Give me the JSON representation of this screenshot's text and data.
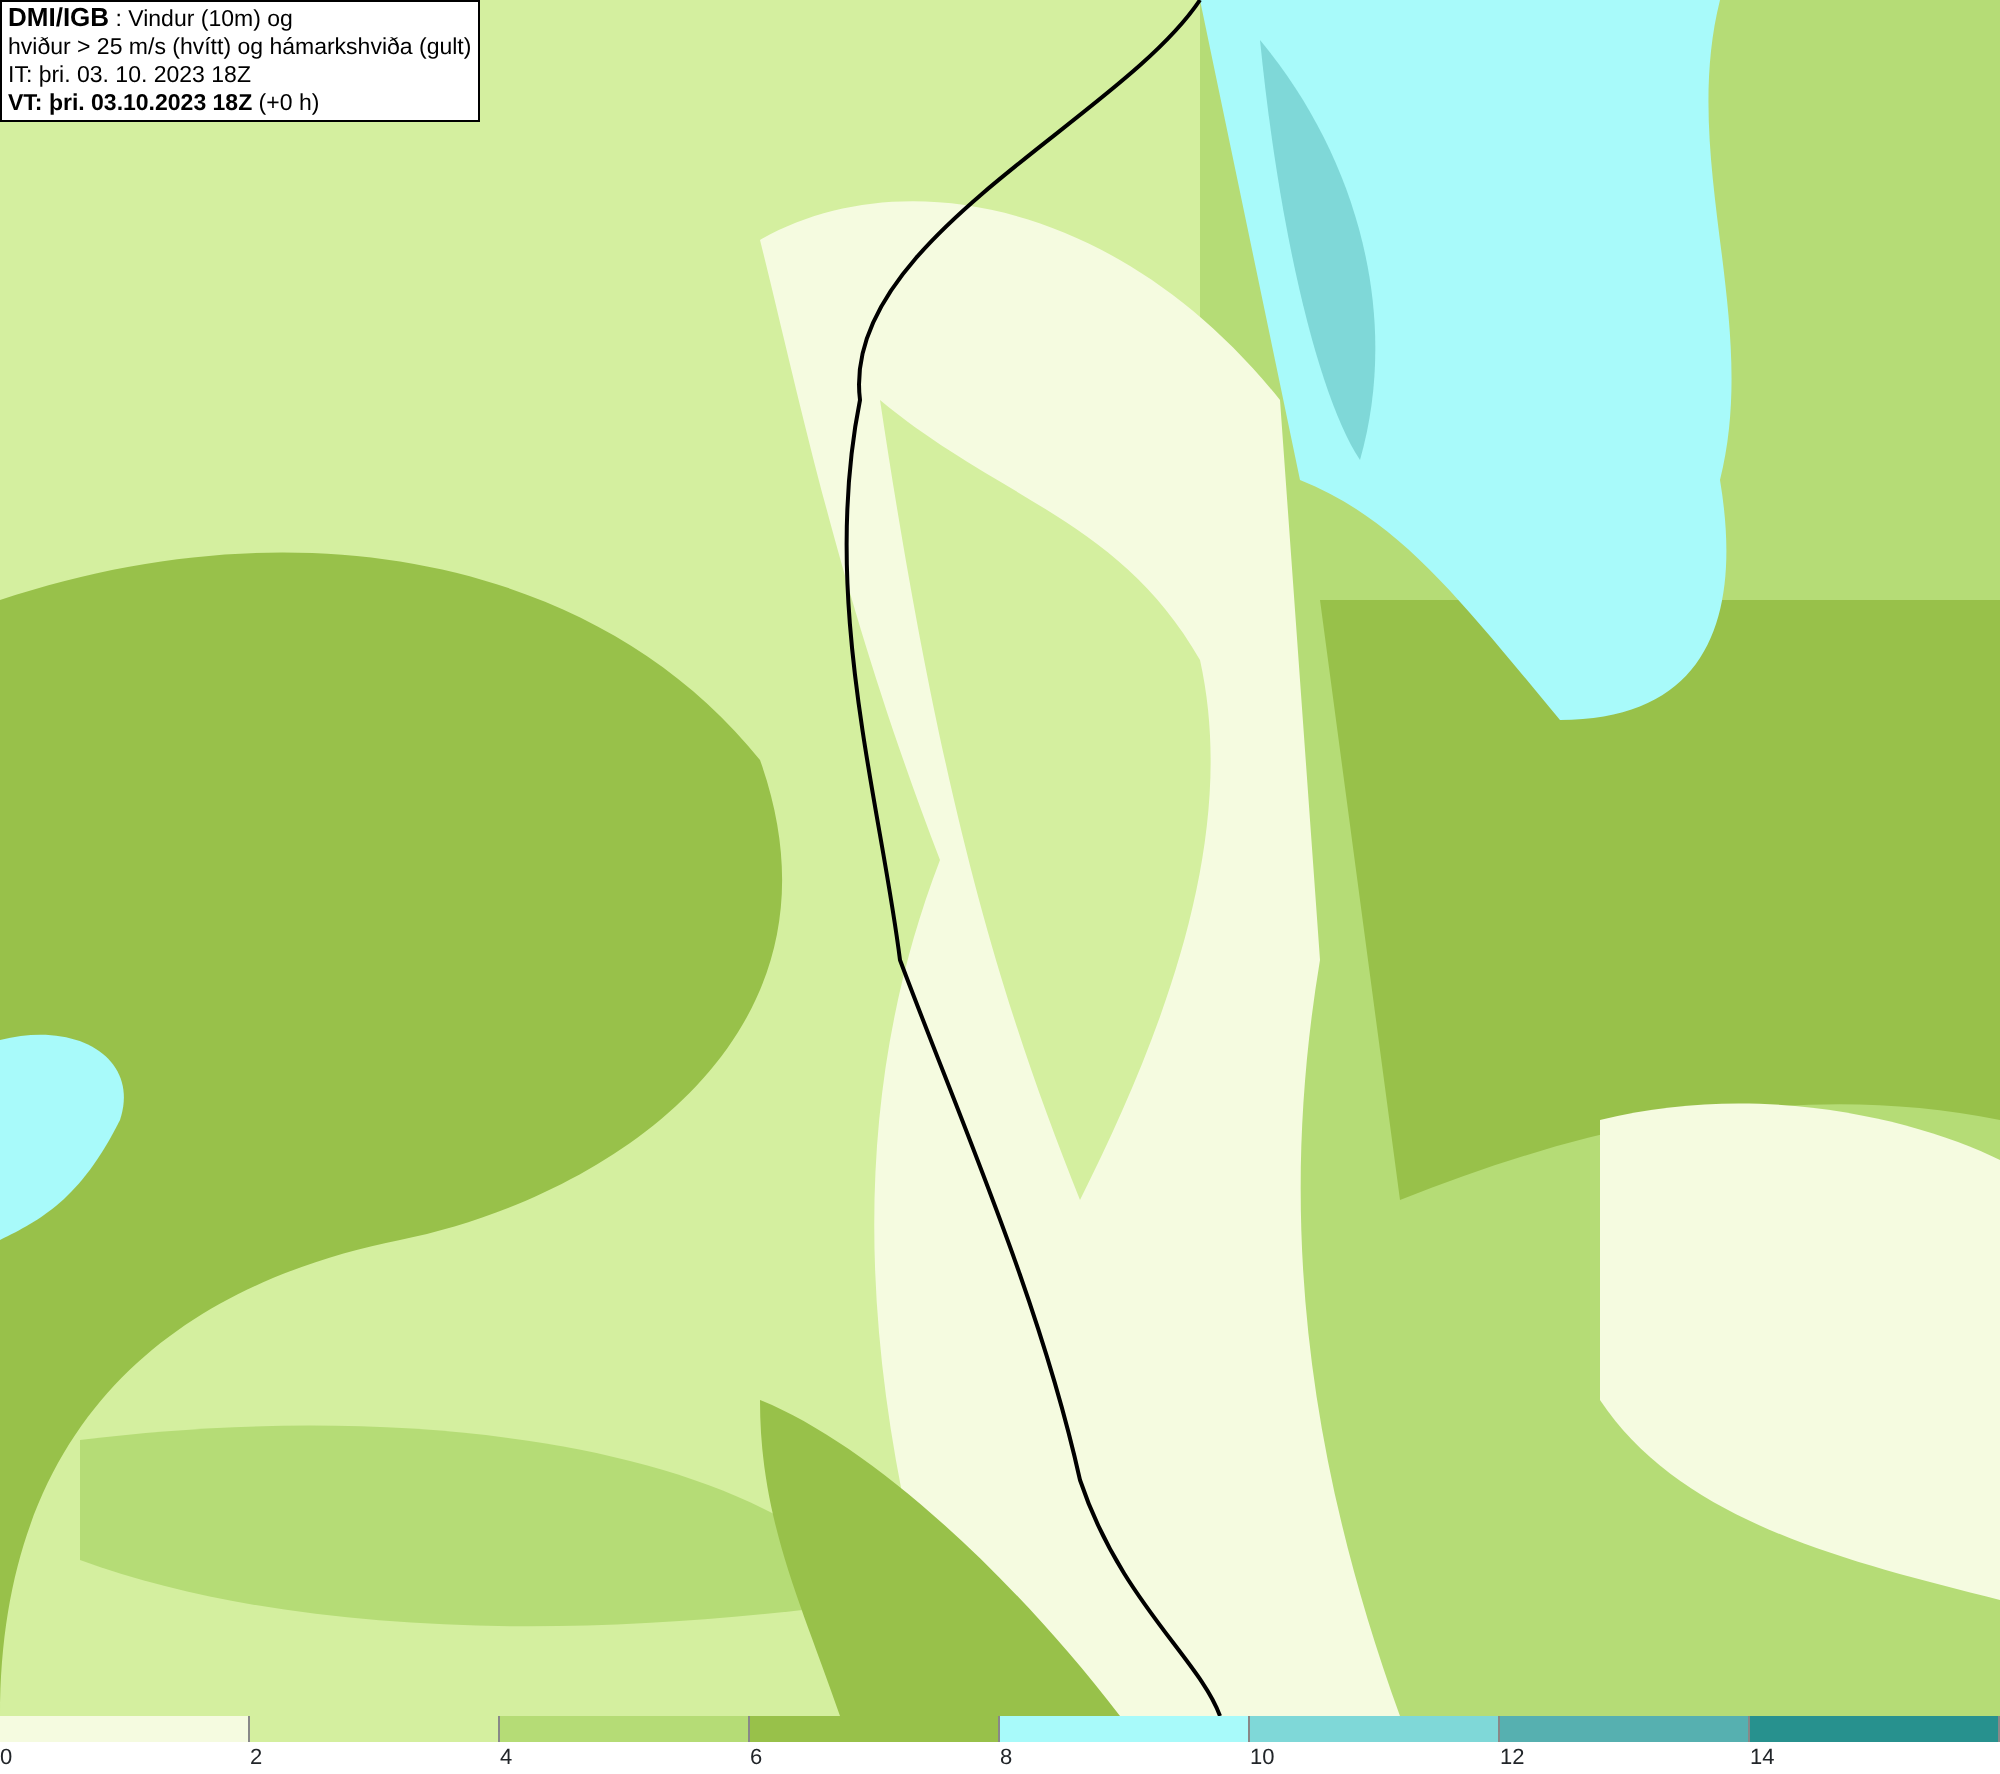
{
  "title_box": {
    "lines": [
      "**DMI/IGB** : Vindur (10m) og",
      "hviður > 25 m/s (hvítt) og hámarkshviða (gult)",
      "IT: þri. 03. 10. 2023 18Z",
      "**VT: þri. 03.10.2023 18Z** (+0 h)"
    ]
  },
  "legend": {
    "segments": [
      {
        "color": "#f5fbe0",
        "label": "0"
      },
      {
        "color": "#d4ef9f",
        "label": "2"
      },
      {
        "color": "#b5dc76",
        "label": "4"
      },
      {
        "color": "#98c14a",
        "label": "6"
      },
      {
        "color": "#a8fafa",
        "label": "8"
      },
      {
        "color": "#7fd8d8",
        "label": "10"
      },
      {
        "color": "#56b0b0",
        "label": "12"
      },
      {
        "color": "#27918e",
        "label": "14"
      }
    ]
  }
}
